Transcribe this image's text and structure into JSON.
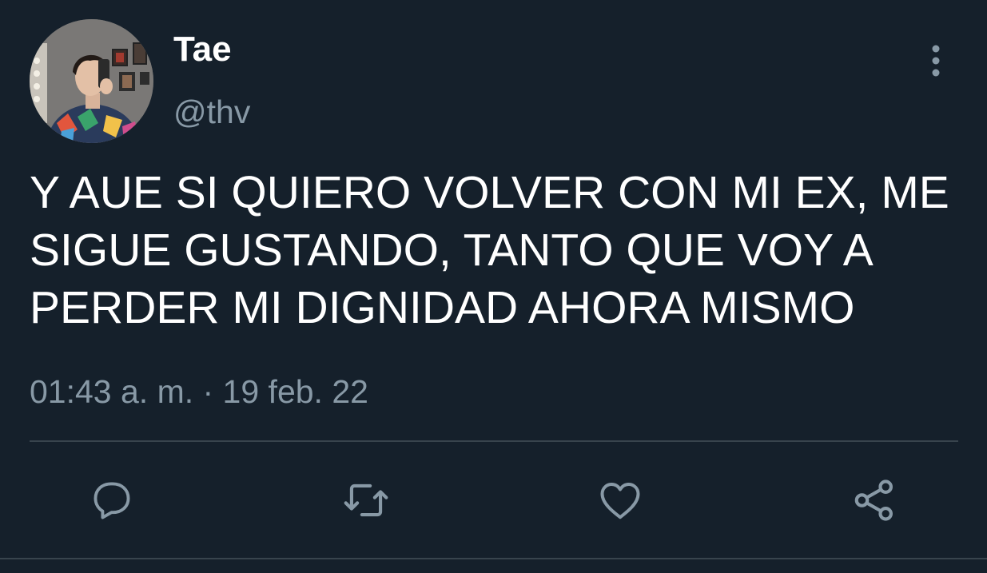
{
  "user": {
    "display_name": "Tae",
    "handle": "@thv",
    "avatar_icon": "profile-photo"
  },
  "tweet": {
    "text": "Y AUE SI QUIERO VOLVER CON MI EX, ME SIGUE GUSTANDO, TANTO QUE VOY A PERDER MI DIGNIDAD AHORA MISMO",
    "timestamp": "01:43 a. m. · 19 feb. 22"
  },
  "actions": [
    {
      "name": "reply",
      "icon": "speech-bubble-icon"
    },
    {
      "name": "retweet",
      "icon": "retweet-icon"
    },
    {
      "name": "like",
      "icon": "heart-icon"
    },
    {
      "name": "share",
      "icon": "share-icon"
    }
  ],
  "colors": {
    "background": "#15202b",
    "primary_text": "#ffffff",
    "secondary_text": "#8899a6",
    "divider": "#38444d"
  }
}
